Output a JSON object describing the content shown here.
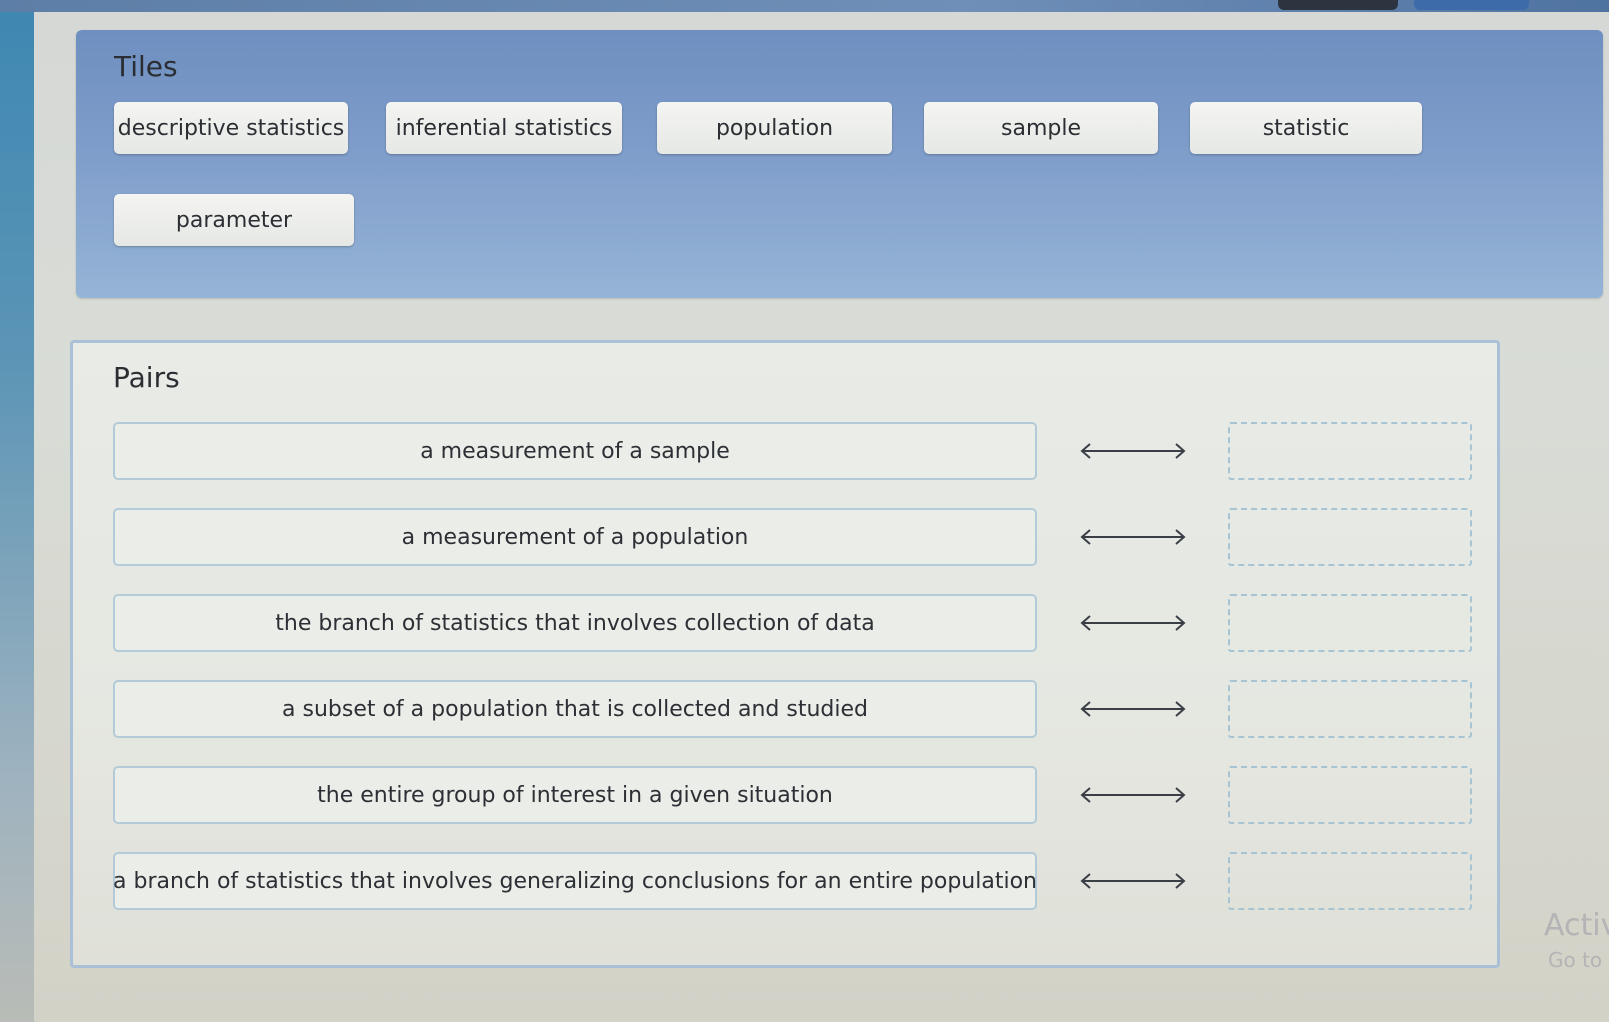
{
  "tiles": {
    "heading": "Tiles",
    "items": [
      {
        "label": "descriptive statistics"
      },
      {
        "label": "inferential statistics"
      },
      {
        "label": "population"
      },
      {
        "label": "sample"
      },
      {
        "label": "statistic"
      },
      {
        "label": "parameter"
      }
    ]
  },
  "pairs": {
    "heading": "Pairs",
    "rows": [
      {
        "definition": "a measurement of a sample"
      },
      {
        "definition": "a measurement of a population"
      },
      {
        "definition": "the branch of statistics that involves collection of data"
      },
      {
        "definition": "a subset of a population that is collected and studied"
      },
      {
        "definition": "the entire group of interest in a given situation"
      },
      {
        "definition": "a branch of statistics that involves generalizing conclusions for an entire population"
      }
    ]
  },
  "watermark": {
    "line1": "Activ",
    "line2": "Go to"
  },
  "icons": {
    "pair_connector": "double-arrow-icon"
  },
  "colors": {
    "tiles_panel": "#7f9dca",
    "pairs_panel": "#e8ebe6",
    "drop_zone_border": "#a6c4d4"
  }
}
